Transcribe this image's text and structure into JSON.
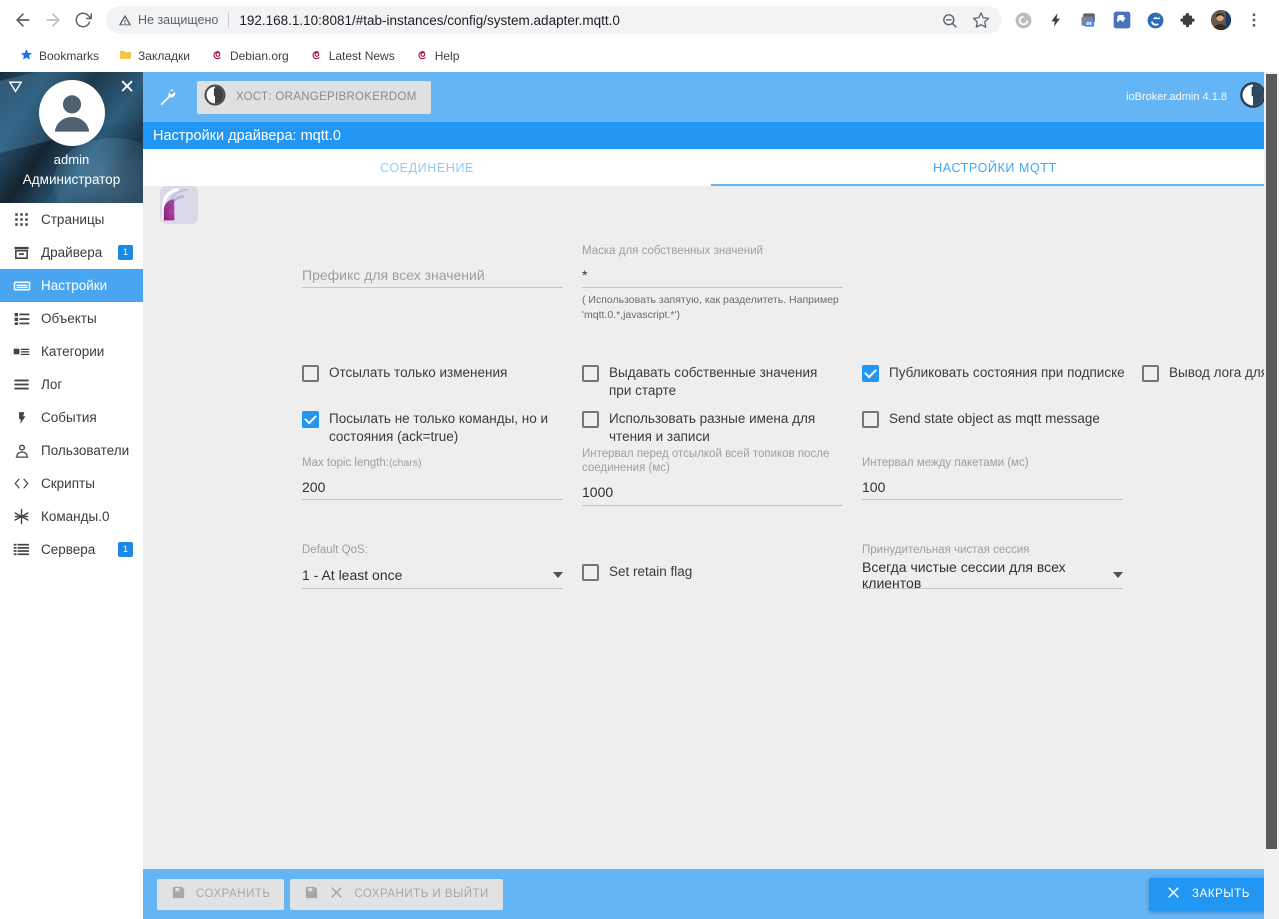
{
  "browser": {
    "nav": {
      "back_icon": "arrow-left-icon",
      "forward_icon": "arrow-right-icon",
      "reload_icon": "reload-icon"
    },
    "omnibox": {
      "security_warning": "Не защищено",
      "security_icon": "warning-triangle-icon",
      "url": "192.168.1.10:8081/#tab-instances/config/system.adapter.mqtt.0",
      "url_host": "192.168.1.10",
      "url_path": ":8081/#tab-instances/config/system.adapter.mqtt.0",
      "zoom_icon": "zoom-out-icon",
      "bookmark_icon": "star-icon"
    },
    "toolbar_icons": [
      "grammar-circle-icon",
      "lightning-bolt-icon",
      "tab-stack-icon",
      "puzzle-blue-icon",
      "edge-e-icon",
      "puzzle-dark-icon",
      "profile-avatar-icon",
      "three-dot-menu-icon"
    ],
    "bookmarks": [
      {
        "label": "Bookmarks",
        "icon": "star-icon"
      },
      {
        "label": "Закладки",
        "icon": "folder-icon"
      },
      {
        "label": "Debian.org",
        "icon": "debian-icon"
      },
      {
        "label": "Latest News",
        "icon": "debian-icon"
      },
      {
        "label": "Help",
        "icon": "debian-icon"
      }
    ]
  },
  "sidebar": {
    "collapse_icon": "collapse-triangle-icon",
    "close_icon": "close-icon",
    "avatar_icon": "user-avatar-icon",
    "user": "admin",
    "role": "Администратор",
    "items": [
      {
        "label": "Страницы",
        "icon": "apps-grid-icon",
        "badge": "",
        "active": false
      },
      {
        "label": "Драйвера",
        "icon": "adapters-icon",
        "badge": "1",
        "active": false
      },
      {
        "label": "Настройки",
        "icon": "instances-icon",
        "badge": "",
        "active": true
      },
      {
        "label": "Объекты",
        "icon": "objects-list-icon",
        "badge": "",
        "active": false
      },
      {
        "label": "Категории",
        "icon": "categories-icon",
        "badge": "",
        "active": false
      },
      {
        "label": "Лог",
        "icon": "log-lines-icon",
        "badge": "",
        "active": false
      },
      {
        "label": "События",
        "icon": "events-bolt-icon",
        "badge": "",
        "active": false
      },
      {
        "label": "Пользователи",
        "icon": "users-icon",
        "badge": "",
        "active": false
      },
      {
        "label": "Скрипты",
        "icon": "code-brackets-icon",
        "badge": "",
        "active": false
      },
      {
        "label": "Команды.0",
        "icon": "snowflake-icon",
        "badge": "",
        "active": false
      },
      {
        "label": "Сервера",
        "icon": "hosts-icon",
        "badge": "1",
        "active": false
      }
    ]
  },
  "topbar": {
    "wrench_icon": "wrench-icon",
    "host_icon": "power-circle-icon",
    "host_label": "ХОСТ: ORANGEPIBROKERDOM",
    "version": "ioBroker.admin 4.1.8",
    "logo_icon": "iobroker-logo-icon"
  },
  "dialog": {
    "title": "Настройки драйвера: mqtt.0",
    "adapter_logo_icon": "mqtt-adapter-logo-icon",
    "tabs": [
      {
        "label": "СОЕДИНЕНИЕ",
        "active": false
      },
      {
        "label": "НАСТРОЙКИ MQTT",
        "active": true
      }
    ]
  },
  "form": {
    "prefix": {
      "placeholder": "Префикс для всех значений",
      "value": ""
    },
    "mask": {
      "label": "Маска для собственных значений",
      "value": "*",
      "hint": "( Использовать запятую, как разделитеть. Например 'mqtt.0.*,javascript.*')"
    },
    "max_topic_length": {
      "label": "Max topic length:",
      "label_small": "(chars)",
      "value": "200"
    },
    "interval_after_connect": {
      "label": "Интервал перед отсылкой всей топиков после соединения (мс)",
      "value": "1000"
    },
    "interval_between_packets": {
      "label": "Интервал между пакетами (мс)",
      "value": "100"
    },
    "default_qos": {
      "label": "Default QoS:",
      "value": "1 - At least once"
    },
    "force_clean_session": {
      "label": "Принудительная чистая сессия",
      "value": "Всегда чистые сессии для всех клиентов"
    },
    "checkboxes": [
      {
        "label": "Отсылать только изменения",
        "checked": false
      },
      {
        "label": "Посылать не только команды, но и состояния (ack=true)",
        "checked": true
      },
      {
        "label": "Выдавать собственные значения при старте",
        "checked": false
      },
      {
        "label": "Использовать разные имена для чтения и записи",
        "checked": false
      },
      {
        "label": "Публиковать состояния при подписке",
        "checked": true
      },
      {
        "label": "Send state object as mqtt message",
        "checked": false
      },
      {
        "label": "Вывод лога для каждого изменения",
        "checked": false
      },
      {
        "label": "Set retain flag",
        "checked": false
      }
    ]
  },
  "footer": {
    "save_label": "СОХРАНИТЬ",
    "save_icon": "save-disk-icon",
    "save_close_label": "СОХРАНИТЬ И ВЫЙТИ",
    "save_close_icon": "save-disk-icon",
    "save_close_x_icon": "close-x-icon",
    "close_label": "ЗАКРЫТЬ",
    "close_icon": "close-x-icon"
  },
  "colors": {
    "topbar": "#64b5f6",
    "dialog_title": "#2196f3",
    "accent": "#2196f3",
    "sidebar_active": "#4aa5f0",
    "badge": "#1e88e5"
  }
}
